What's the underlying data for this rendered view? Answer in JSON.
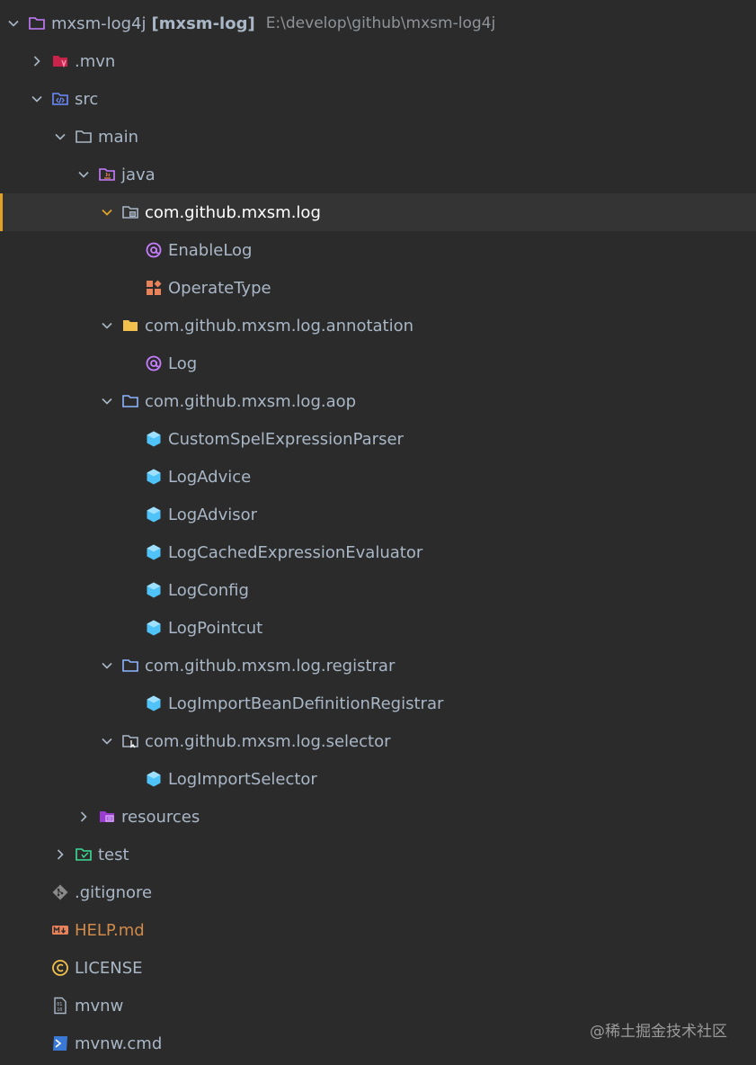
{
  "project": {
    "name": "mxsm-log4j",
    "module_label": "[mxsm-log]",
    "path": "E:\\develop\\github\\mxsm-log4j"
  },
  "tree": {
    "mvn": ".mvn",
    "src": "src",
    "main": "main",
    "java": "java",
    "pkg_root": "com.github.mxsm.log",
    "enable_log": "EnableLog",
    "operate_type": "OperateType",
    "pkg_annotation": "com.github.mxsm.log.annotation",
    "log": "Log",
    "pkg_aop": "com.github.mxsm.log.aop",
    "custom_spel": "CustomSpelExpressionParser",
    "log_advice": "LogAdvice",
    "log_advisor": "LogAdvisor",
    "log_cached": "LogCachedExpressionEvaluator",
    "log_config": "LogConfig",
    "log_pointcut": "LogPointcut",
    "pkg_registrar": "com.github.mxsm.log.registrar",
    "log_import_registrar": "LogImportBeanDefinitionRegistrar",
    "pkg_selector": "com.github.mxsm.log.selector",
    "log_import_selector": "LogImportSelector",
    "resources": "resources",
    "test": "test",
    "gitignore": ".gitignore",
    "help_md": "HELP.md",
    "license": "LICENSE",
    "mvnw": "mvnw",
    "mvnw_cmd": "mvnw.cmd"
  },
  "watermark": "@稀土掘金技术社区",
  "colors": {
    "background": "#2b2b2b",
    "selected_row": "#343434",
    "selection_accent": "#e0a327",
    "text": "#a9b7c6",
    "class_icon": "#4fc3f7",
    "annotation_icon": "#c77dff",
    "enum_icon": "#e8825a",
    "help_text": "#d08a4a"
  }
}
